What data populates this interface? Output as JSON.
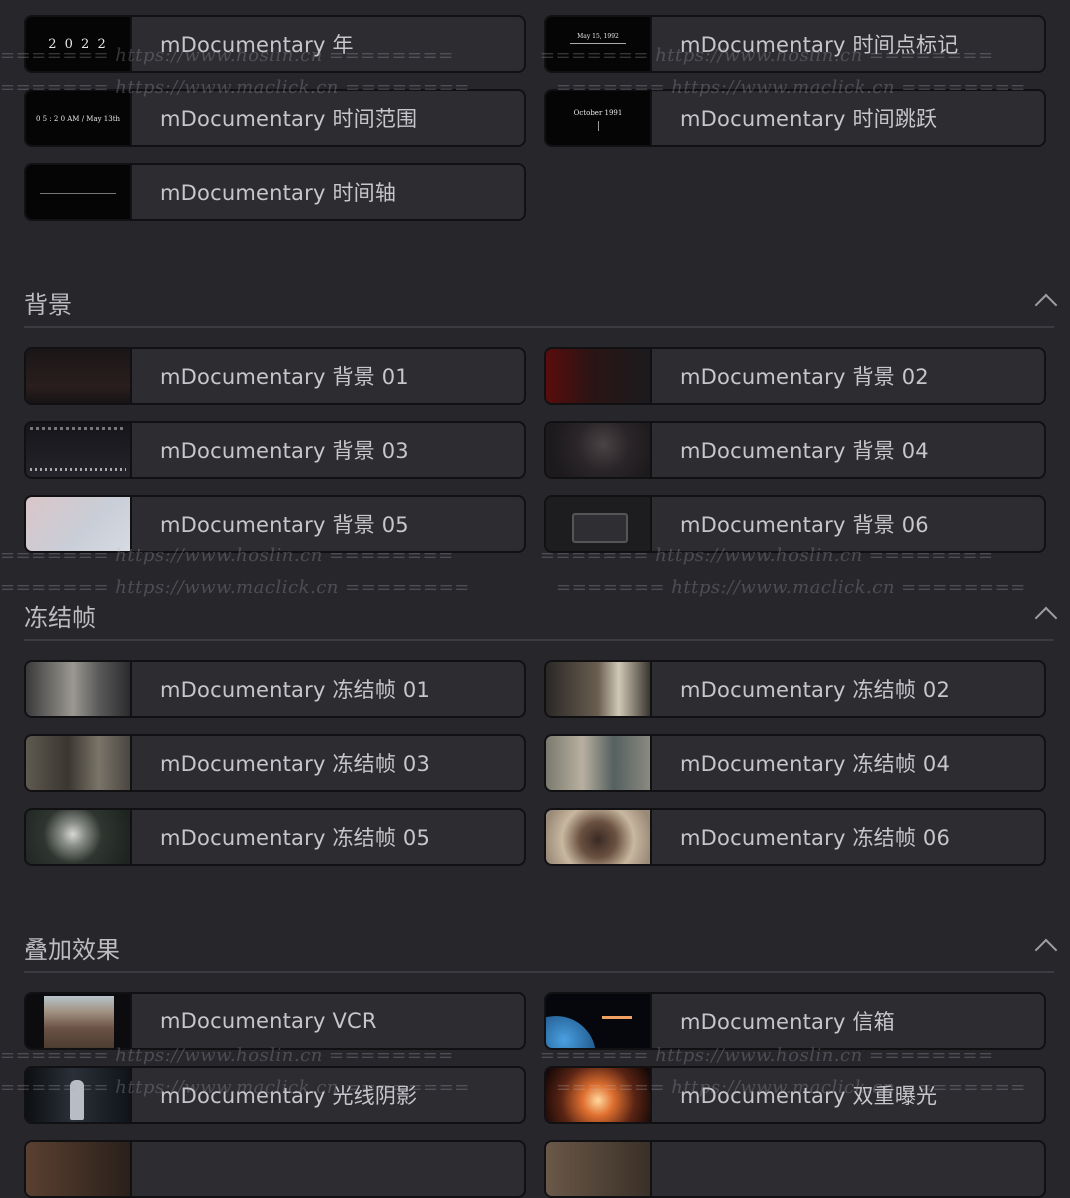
{
  "top_items": [
    {
      "label": "mDocumentary 年",
      "thumb_text": "2 0 2 2"
    },
    {
      "label": "mDocumentary 时间点标记",
      "thumb_text": "May 15, 1992"
    },
    {
      "label": "mDocumentary 时间范围",
      "thumb_text": "0 5 : 2 0  AM / May 13th"
    },
    {
      "label": "mDocumentary 时间跳跃",
      "thumb_text": "October 1991"
    },
    {
      "label": "mDocumentary 时间轴",
      "thumb_text": ""
    }
  ],
  "sections": [
    {
      "title": "背景",
      "items": [
        {
          "label": "mDocumentary 背景 01"
        },
        {
          "label": "mDocumentary 背景 02"
        },
        {
          "label": "mDocumentary 背景 03"
        },
        {
          "label": "mDocumentary 背景 04"
        },
        {
          "label": "mDocumentary 背景 05"
        },
        {
          "label": "mDocumentary 背景 06"
        }
      ]
    },
    {
      "title": "冻结帧",
      "items": [
        {
          "label": "mDocumentary 冻结帧 01"
        },
        {
          "label": "mDocumentary 冻结帧 02"
        },
        {
          "label": "mDocumentary 冻结帧 03"
        },
        {
          "label": "mDocumentary 冻结帧 04"
        },
        {
          "label": "mDocumentary 冻结帧 05"
        },
        {
          "label": "mDocumentary 冻结帧 06"
        }
      ]
    },
    {
      "title": "叠加效果",
      "items": [
        {
          "label": "mDocumentary VCR"
        },
        {
          "label": "mDocumentary 信箱"
        },
        {
          "label": "mDocumentary 光线阴影"
        },
        {
          "label": "mDocumentary 双重曝光"
        }
      ]
    }
  ],
  "watermarks": {
    "hoslin": "======= https://www.hoslin.cn ========",
    "maclick": "======= https://www.maclick.cn ========"
  }
}
